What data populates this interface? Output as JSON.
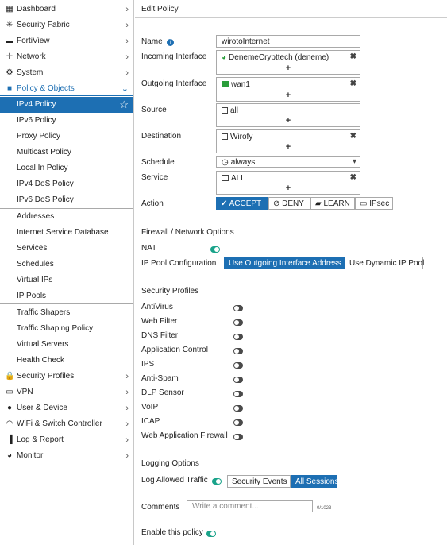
{
  "sidebar": {
    "items": [
      {
        "label": "Dashboard",
        "icon": "dashboard-icon",
        "glyph": "▦",
        "chevron": "›"
      },
      {
        "label": "Security Fabric",
        "icon": "security-fabric-icon",
        "glyph": "✳",
        "chevron": "›"
      },
      {
        "label": "FortiView",
        "icon": "fortiview-icon",
        "glyph": "▬",
        "chevron": "›"
      },
      {
        "label": "Network",
        "icon": "network-icon",
        "glyph": "✛",
        "chevron": "›"
      },
      {
        "label": "System",
        "icon": "gear-icon",
        "glyph": "⚙",
        "chevron": "›"
      },
      {
        "label": "Policy & Objects",
        "icon": "policy-icon",
        "glyph": "■",
        "chevron": "⌄"
      },
      {
        "label": "IPv4 Policy",
        "star": "☆"
      },
      {
        "label": "IPv6 Policy"
      },
      {
        "label": "Proxy Policy"
      },
      {
        "label": "Multicast Policy"
      },
      {
        "label": "Local In Policy"
      },
      {
        "label": "IPv4 DoS Policy"
      },
      {
        "label": "IPv6 DoS Policy"
      },
      {
        "label": "Addresses"
      },
      {
        "label": "Internet Service Database"
      },
      {
        "label": "Services"
      },
      {
        "label": "Schedules"
      },
      {
        "label": "Virtual IPs"
      },
      {
        "label": "IP Pools"
      },
      {
        "label": "Traffic Shapers"
      },
      {
        "label": "Traffic Shaping Policy"
      },
      {
        "label": "Virtual Servers"
      },
      {
        "label": "Health Check"
      },
      {
        "label": "Security Profiles",
        "icon": "lock-icon",
        "glyph": "🔒",
        "chevron": "›"
      },
      {
        "label": "VPN",
        "icon": "vpn-icon",
        "glyph": "▭",
        "chevron": "›"
      },
      {
        "label": "User & Device",
        "icon": "user-icon",
        "glyph": "●",
        "chevron": "›"
      },
      {
        "label": "WiFi & Switch Controller",
        "icon": "wifi-icon",
        "glyph": "◠",
        "chevron": "›"
      },
      {
        "label": "Log & Report",
        "icon": "log-report-icon",
        "glyph": "▐",
        "chevron": "›"
      },
      {
        "label": "Monitor",
        "icon": "monitor-icon",
        "glyph": "◕",
        "chevron": "›"
      }
    ]
  },
  "header": {
    "title": "Edit Policy"
  },
  "form": {
    "name_label": "Name",
    "name_info": "i",
    "name_value": "wirotoInternet",
    "incoming_label": "Incoming Interface",
    "incoming_value": "DenemeCrypttech (deneme)",
    "outgoing_label": "Outgoing Interface",
    "outgoing_value": "wan1",
    "source_label": "Source",
    "source_value": "all",
    "destination_label": "Destination",
    "destination_value": "Wirofy",
    "schedule_label": "Schedule",
    "schedule_value": "always",
    "service_label": "Service",
    "service_value": "ALL",
    "action_label": "Action",
    "action_options": [
      "✔ ACCEPT",
      "⊘ DENY",
      "▰ LEARN",
      "▭ IPsec"
    ],
    "remove_glyph": "✖",
    "add_glyph": "+",
    "dropdown_glyph": "▾"
  },
  "firewall": {
    "title": "Firewall / Network Options",
    "nat_label": "NAT",
    "nat_on": true,
    "ippool_label": "IP Pool Configuration",
    "ippool_options": [
      "Use Outgoing Interface Address",
      "Use Dynamic IP Pool"
    ]
  },
  "security_profiles": {
    "title": "Security Profiles",
    "items": [
      {
        "label": "AntiVirus",
        "on": false
      },
      {
        "label": "Web Filter",
        "on": false
      },
      {
        "label": "DNS Filter",
        "on": false
      },
      {
        "label": "Application Control",
        "on": false
      },
      {
        "label": "IPS",
        "on": false
      },
      {
        "label": "Anti-Spam",
        "on": false
      },
      {
        "label": "DLP Sensor",
        "on": false
      },
      {
        "label": "VoIP",
        "on": false
      },
      {
        "label": "ICAP",
        "on": false
      },
      {
        "label": "Web Application Firewall",
        "on": false
      }
    ]
  },
  "logging": {
    "title": "Logging Options",
    "log_label": "Log Allowed Traffic",
    "log_on": true,
    "options": [
      "Security Events",
      "All Sessions"
    ]
  },
  "comments": {
    "label": "Comments",
    "placeholder": "Write a comment...",
    "counter": "0/1023"
  },
  "enable": {
    "label": "Enable this policy",
    "on": true
  }
}
